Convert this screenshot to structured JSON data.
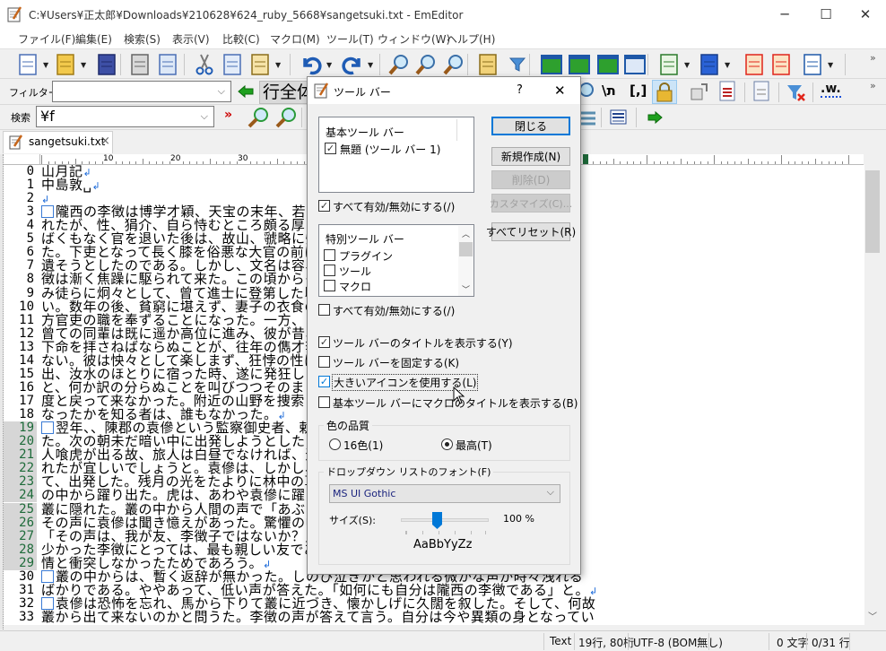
{
  "window": {
    "title": "C:¥Users¥正太郎¥Downloads¥210628¥624_ruby_5668¥sangetsuki.txt - EmEditor",
    "minimize": "─",
    "maximize": "☐",
    "close": "✕"
  },
  "menu": [
    "ファイル(F)",
    "編集(E)",
    "検索(S)",
    "表示(V)",
    "比較(C)",
    "マクロ(M)",
    "ツール(T)",
    "ウィンドウ(W)",
    "ヘルプ(H)"
  ],
  "toolbar1": [
    "new-file-icon",
    "open-file-icon",
    "save-icon",
    "print-icon",
    "print-preview-icon",
    "cut-icon",
    "copy-icon",
    "paste-icon",
    "undo-icon",
    "redo-icon",
    "find-icon",
    "find-next-icon",
    "find-previous-icon",
    "find-in-files-icon",
    "filter-icon",
    "jump-icon",
    "replace-icon",
    "wrap-icon",
    "refresh-icon",
    "outline-icon",
    "spell-check-icon",
    "bookmark-icon",
    "bookmarks-icon",
    "validate-icon"
  ],
  "filterbar": {
    "label": "フィルター",
    "value": "",
    "line_mode": "行全体",
    "more": "»"
  },
  "searchbar": {
    "label": "検索",
    "value": "¥f"
  },
  "toolbar_overflow": "»",
  "tab": {
    "label": "sangetsuki.txt",
    "close": "×"
  },
  "ruler": {
    "marks": [
      "10",
      "20",
      "30"
    ]
  },
  "editor": {
    "lines": [
      {
        "n": "0",
        "t": "山月記",
        "eol": true
      },
      {
        "n": "1",
        "t": "中島敦␣",
        "eol": true
      },
      {
        "n": "2",
        "t": "",
        "eol": true
      },
      {
        "n": "3",
        "t": "隴西の李徴は博学才穎、天宝の末年、若く",
        "indent": true
      },
      {
        "n": "4",
        "t": "れたが、性、狷介、自ら恃むところ頗る厚く"
      },
      {
        "n": "5",
        "t": "ばくもなく官を退いた後は、故山、虢略に帰"
      },
      {
        "n": "6",
        "t": "た。下吏となって長く膝を俗悪な大官の前に"
      },
      {
        "n": "7",
        "t": "遺そうとしたのである。しかし、文名は容易"
      },
      {
        "n": "8",
        "t": "徴は漸く焦躁に駆られて来た。この頃からそ"
      },
      {
        "n": "9",
        "t": "み徒らに炯々として、曾て進士に登第した頃"
      },
      {
        "n": "10",
        "t": "い。数年の後、貧窮に堪えず、妻子の衣食の"
      },
      {
        "n": "11",
        "t": "方官吏の職を奉ずることになった。一方、こ"
      },
      {
        "n": "12",
        "t": "曾ての同輩は既に遥か高位に進み、彼が昔、"
      },
      {
        "n": "13",
        "t": "下命を拝さねばならぬことが、往年の儁才李"
      },
      {
        "n": "14",
        "t": "ない。彼は怏々として楽しまず、狂悖の性は"
      },
      {
        "n": "15",
        "t": "出、汝水のほとりに宿った時、遂に発狂した"
      },
      {
        "n": "16",
        "t": "と、何か訳の分らぬことを叫びつつそのまま"
      },
      {
        "n": "17",
        "t": "度と戻って来なかった。附近の山野を捜索し"
      },
      {
        "n": "18",
        "t": "なったかを知る者は、誰もなかった。",
        "eol": true
      },
      {
        "n": "19",
        "t": "翌年、、陳郡の袁傪という監察御史者、勅",
        "indent": true,
        "sel": true
      },
      {
        "n": "20",
        "t": "た。次の朝未だ暗い中に出発しようとしたと",
        "sel": true
      },
      {
        "n": "21",
        "t": "人喰虎が出る故、旅人は白昼でなければ、通",
        "sel": true
      },
      {
        "n": "22",
        "t": "れたが宜しいでしょうと。袁傪は、しかし、",
        "sel": true
      },
      {
        "n": "23",
        "t": "て、出発した。残月の光をたよりに林中の草",
        "sel": true
      },
      {
        "n": "24",
        "t": "の中から躍り出た。虎は、あわや袁傪に躍り",
        "sel": true
      },
      {
        "n": "25",
        "t": "叢に隠れた。叢の中から人間の声で「あぶな",
        "sel": true
      },
      {
        "n": "26",
        "t": "その声に袁傪は聞き憶えがあった。驚懼の中",
        "sel": true
      },
      {
        "n": "27",
        "t": "「その声は、我が友、李徴子ではないか？」",
        "sel": true
      },
      {
        "n": "28",
        "t": "少かった李徴にとっては、最も親しい友であ",
        "sel": true
      },
      {
        "n": "29",
        "t": "情と衝突しなかったためであろう。",
        "eol": true,
        "sel": true
      },
      {
        "n": "30",
        "t": "叢の中からは、暫く返辞が無かった。しのび泣きかと思われる微かな声が時々洩れる",
        "indent": true
      },
      {
        "n": "31",
        "t": "ばかりである。ややあって、低い声が答えた。「如何にも自分は隴西の李徴である」と。",
        "eol": true
      },
      {
        "n": "32",
        "t": "袁傪は恐怖を忘れ、馬から下りて叢に近づき、懐かしげに久闊を叙した。そして、何故",
        "indent": true
      },
      {
        "n": "33",
        "t": "叢から出て来ないのかと問うた。李徴の声が答えて言う。自分は今や異類の身となってい"
      }
    ]
  },
  "statusbar": {
    "mode": "Text",
    "position": "19行, 80桁",
    "encoding": "UTF-8 (BOM無し)",
    "chars": "0 文字",
    "lines": "0/31 行"
  },
  "dialog": {
    "title": "ツール バー",
    "help": "?",
    "close": "✕",
    "basic_list": {
      "header": "基本ツール バー",
      "items": [
        {
          "label": "無題 (ツール バー 1)",
          "checked": true
        }
      ]
    },
    "basic_all": {
      "label": "すべて有効/無効にする(/)",
      "checked": true
    },
    "special_list": {
      "header": "特別ツール バー",
      "items": [
        {
          "label": "プラグイン",
          "checked": false
        },
        {
          "label": "ツール",
          "checked": false
        },
        {
          "label": "マクロ",
          "checked": false
        }
      ]
    },
    "special_all": {
      "label": "すべて有効/無効にする(/)",
      "checked": false
    },
    "buttons": {
      "close": "閉じる",
      "new": "新規作成(N)",
      "delete": "削除(D)",
      "customize": "カスタマイズ(C)...",
      "reset": "すべてリセット(R)"
    },
    "options": [
      {
        "label": "ツール バーのタイトルを表示する(Y)",
        "checked": true
      },
      {
        "label": "ツール バーを固定する(K)",
        "checked": false
      },
      {
        "label": "大きいアイコンを使用する(L)",
        "checked": true
      },
      {
        "label": "基本ツール バーにマクロのタイトルを表示する(B)",
        "checked": false
      }
    ],
    "color_quality": {
      "label": "色の品質",
      "options": [
        "16色(1)",
        "最高(T)"
      ],
      "selected": "最高(T)"
    },
    "font_group": {
      "label": "ドロップダウン リストのフォント(F)",
      "font": "MS UI Gothic",
      "size_label": "サイズ(S):",
      "size_value": "100 %",
      "size_percent": 100,
      "sample": "AaBbYyZz"
    }
  }
}
